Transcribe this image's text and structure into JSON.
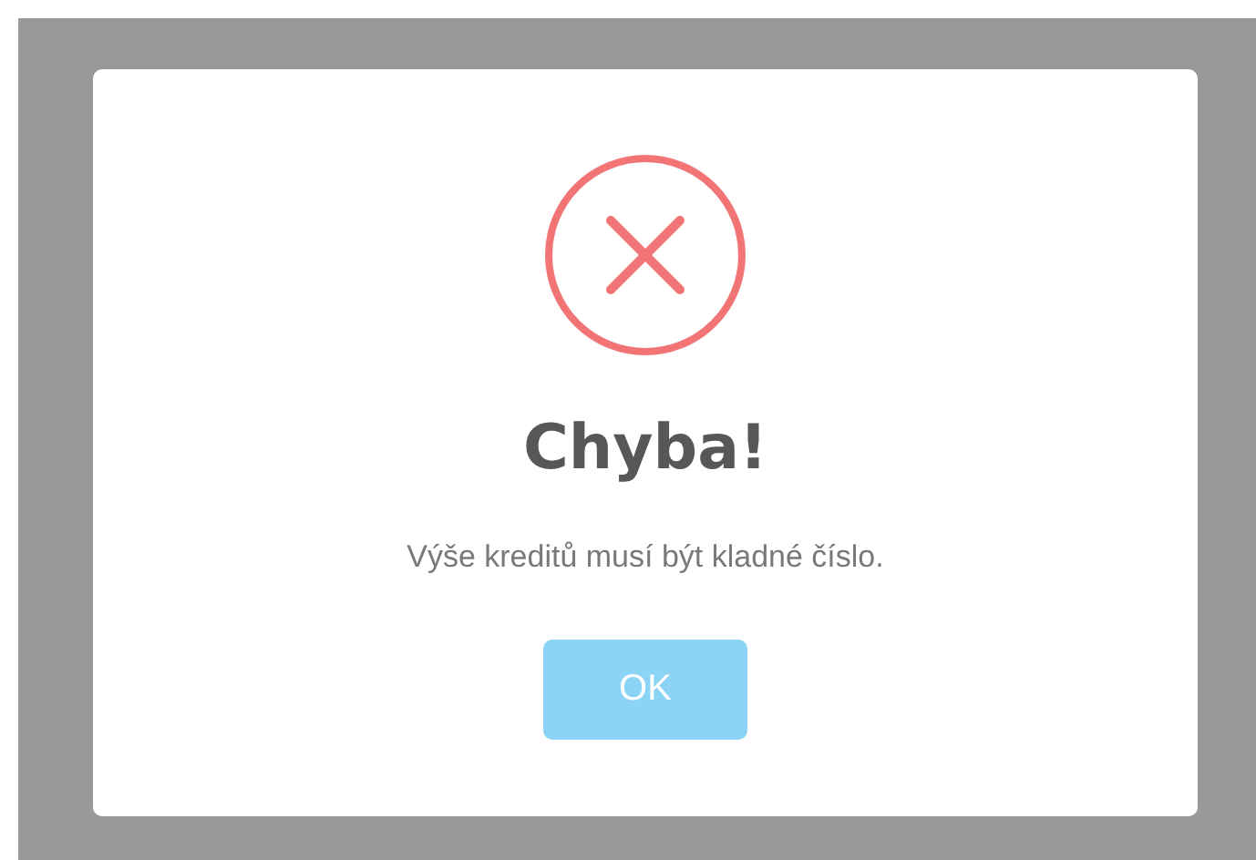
{
  "dialog": {
    "icon": {
      "kind": "error"
    },
    "title": "Chyba!",
    "message": "Výše kreditů musí být kladné číslo.",
    "button": "OK"
  }
}
